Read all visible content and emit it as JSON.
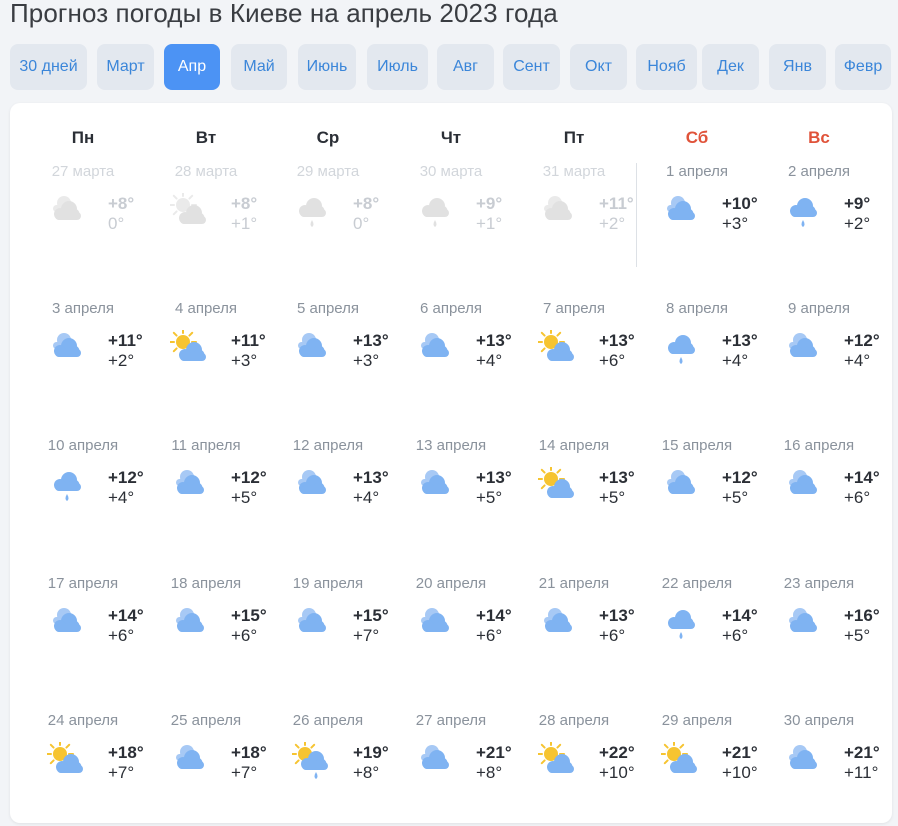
{
  "page": {
    "title": "Прогноз погоды в Киеве на апрель 2023 года"
  },
  "tabs": [
    {
      "label": "30 дней",
      "active": false
    },
    {
      "label": "Март",
      "active": false
    },
    {
      "label": "Апр",
      "active": true
    },
    {
      "label": "Май",
      "active": false
    },
    {
      "label": "Июнь",
      "active": false
    },
    {
      "label": "Июль",
      "active": false
    },
    {
      "label": "Авг",
      "active": false
    },
    {
      "label": "Сент",
      "active": false
    },
    {
      "label": "Окт",
      "active": false
    },
    {
      "label": "Нояб",
      "active": false
    },
    {
      "label": "Дек",
      "active": false
    },
    {
      "label": "Янв",
      "active": false
    },
    {
      "label": "Февр",
      "active": false
    }
  ],
  "weekdays": [
    {
      "label": "Пн",
      "weekend": false
    },
    {
      "label": "Вт",
      "weekend": false
    },
    {
      "label": "Ср",
      "weekend": false
    },
    {
      "label": "Чт",
      "weekend": false
    },
    {
      "label": "Пт",
      "weekend": false
    },
    {
      "label": "Сб",
      "weekend": true
    },
    {
      "label": "Вс",
      "weekend": true
    }
  ],
  "colors": {
    "accent": "#4c93f4",
    "tab_bg": "#e3e8ef",
    "tab_text": "#3b86d9",
    "weekend": "#e0533a",
    "cloud": "#7fb3f2",
    "sun": "#f6c431"
  },
  "days": [
    {
      "date": "27 марта",
      "icon": "cloudy-icon",
      "tmax": "+8°",
      "tmin": "0°",
      "past": true
    },
    {
      "date": "28 марта",
      "icon": "sun-cloud-icon",
      "tmax": "+8°",
      "tmin": "+1°",
      "past": true
    },
    {
      "date": "29 марта",
      "icon": "rain-icon",
      "tmax": "+8°",
      "tmin": "0°",
      "past": true
    },
    {
      "date": "30 марта",
      "icon": "rain-icon",
      "tmax": "+9°",
      "tmin": "+1°",
      "past": true
    },
    {
      "date": "31 марта",
      "icon": "cloudy-icon",
      "tmax": "+11°",
      "tmin": "+2°",
      "past": true
    },
    {
      "date": "1 апреля",
      "icon": "cloudy-icon",
      "tmax": "+10°",
      "tmin": "+3°",
      "past": false
    },
    {
      "date": "2 апреля",
      "icon": "rain-icon",
      "tmax": "+9°",
      "tmin": "+2°",
      "past": false
    },
    {
      "date": "3 апреля",
      "icon": "cloudy-icon",
      "tmax": "+11°",
      "tmin": "+2°",
      "past": false
    },
    {
      "date": "4 апреля",
      "icon": "sun-cloud-icon",
      "tmax": "+11°",
      "tmin": "+3°",
      "past": false
    },
    {
      "date": "5 апреля",
      "icon": "cloudy-icon",
      "tmax": "+13°",
      "tmin": "+3°",
      "past": false
    },
    {
      "date": "6 апреля",
      "icon": "cloudy-icon",
      "tmax": "+13°",
      "tmin": "+4°",
      "past": false
    },
    {
      "date": "7 апреля",
      "icon": "sun-cloud-icon",
      "tmax": "+13°",
      "tmin": "+6°",
      "past": false
    },
    {
      "date": "8 апреля",
      "icon": "rain-icon",
      "tmax": "+13°",
      "tmin": "+4°",
      "past": false
    },
    {
      "date": "9 апреля",
      "icon": "cloudy-icon",
      "tmax": "+12°",
      "tmin": "+4°",
      "past": false
    },
    {
      "date": "10 апреля",
      "icon": "rain-icon",
      "tmax": "+12°",
      "tmin": "+4°",
      "past": false
    },
    {
      "date": "11 апреля",
      "icon": "cloudy-icon",
      "tmax": "+12°",
      "tmin": "+5°",
      "past": false
    },
    {
      "date": "12 апреля",
      "icon": "cloudy-icon",
      "tmax": "+13°",
      "tmin": "+4°",
      "past": false
    },
    {
      "date": "13 апреля",
      "icon": "cloudy-icon",
      "tmax": "+13°",
      "tmin": "+5°",
      "past": false
    },
    {
      "date": "14 апреля",
      "icon": "sun-cloud-icon",
      "tmax": "+13°",
      "tmin": "+5°",
      "past": false
    },
    {
      "date": "15 апреля",
      "icon": "cloudy-icon",
      "tmax": "+12°",
      "tmin": "+5°",
      "past": false
    },
    {
      "date": "16 апреля",
      "icon": "cloudy-icon",
      "tmax": "+14°",
      "tmin": "+6°",
      "past": false
    },
    {
      "date": "17 апреля",
      "icon": "cloudy-icon",
      "tmax": "+14°",
      "tmin": "+6°",
      "past": false
    },
    {
      "date": "18 апреля",
      "icon": "cloudy-icon",
      "tmax": "+15°",
      "tmin": "+6°",
      "past": false
    },
    {
      "date": "19 апреля",
      "icon": "cloudy-icon",
      "tmax": "+15°",
      "tmin": "+7°",
      "past": false
    },
    {
      "date": "20 апреля",
      "icon": "cloudy-icon",
      "tmax": "+14°",
      "tmin": "+6°",
      "past": false
    },
    {
      "date": "21 апреля",
      "icon": "cloudy-icon",
      "tmax": "+13°",
      "tmin": "+6°",
      "past": false
    },
    {
      "date": "22 апреля",
      "icon": "rain-icon",
      "tmax": "+14°",
      "tmin": "+6°",
      "past": false
    },
    {
      "date": "23 апреля",
      "icon": "cloudy-icon",
      "tmax": "+16°",
      "tmin": "+5°",
      "past": false
    },
    {
      "date": "24 апреля",
      "icon": "sun-cloud-icon",
      "tmax": "+18°",
      "tmin": "+7°",
      "past": false
    },
    {
      "date": "25 апреля",
      "icon": "cloudy-icon",
      "tmax": "+18°",
      "tmin": "+7°",
      "past": false
    },
    {
      "date": "26 апреля",
      "icon": "sun-rain-icon",
      "tmax": "+19°",
      "tmin": "+8°",
      "past": false
    },
    {
      "date": "27 апреля",
      "icon": "cloudy-icon",
      "tmax": "+21°",
      "tmin": "+8°",
      "past": false
    },
    {
      "date": "28 апреля",
      "icon": "sun-cloud-icon",
      "tmax": "+22°",
      "tmin": "+10°",
      "past": false
    },
    {
      "date": "29 апреля",
      "icon": "sun-cloud-icon",
      "tmax": "+21°",
      "tmin": "+10°",
      "past": false
    },
    {
      "date": "30 апреля",
      "icon": "cloudy-icon",
      "tmax": "+21°",
      "tmin": "+11°",
      "past": false
    }
  ]
}
